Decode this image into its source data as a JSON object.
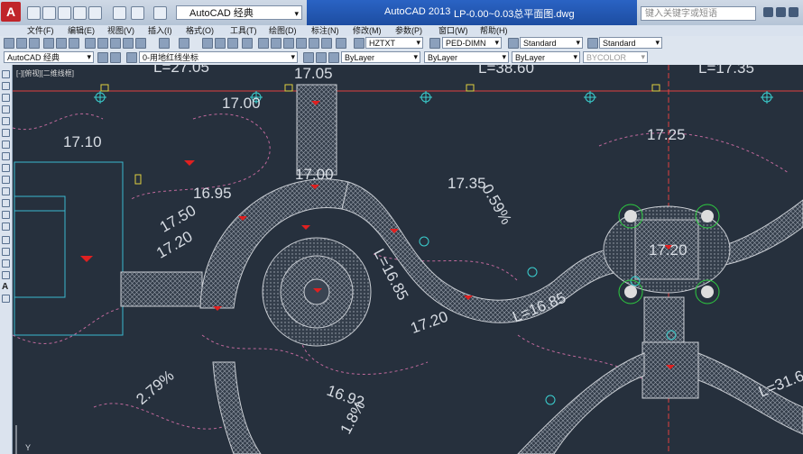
{
  "titlebar": {
    "workspace": "AutoCAD 经典",
    "app_version": "AutoCAD 2013",
    "document": "LP-0.00~0.03总平面图.dwg",
    "search_placeholder": "键入关键字或短语"
  },
  "menu": {
    "items": [
      "文件(F)",
      "编辑(E)",
      "视图(V)",
      "插入(I)",
      "格式(O)",
      "工具(T)",
      "绘图(D)",
      "标注(N)",
      "修改(M)",
      "参数(P)",
      "窗口(W)",
      "帮助(H)"
    ]
  },
  "styles_toolbar": {
    "text_style": "HZTXT",
    "dim_style": "PED-DIMN",
    "table_style": "Standard",
    "multileader_style": "Standard"
  },
  "layers_toolbar": {
    "workspace": "AutoCAD 经典",
    "current_layer": "0-用地红线坐标",
    "color": "ByLayer",
    "linetype": "ByLayer",
    "lineweight": "ByLayer",
    "plot_style": "BYCOLOR"
  },
  "viewport": {
    "label": "[-][俯视][二维线框]"
  },
  "drawing": {
    "labels": {
      "l_top_left": "L=27.05",
      "l_top_mid": "17.05",
      "l_top_right": "L=38.60",
      "l_top_far": "L=17.35",
      "e_17_00_a": "17.00",
      "e_17_10": "17.10",
      "e_17_25": "17.25",
      "e_17_00_b": "17.00",
      "e_16_95": "16.95",
      "e_17_35": "17.35",
      "slope_059": "0.59%",
      "e_17_50": "17.50",
      "e_17_20_a": "17.20",
      "l_16_85_a": "L=16.85",
      "l_16_85_b": "L=16.85",
      "e_17_20_b": "17.20",
      "e_17_20_c": "17.20",
      "slope_279": "2.79%",
      "e_16_92": "16.92",
      "slope_1_8": "1.8%",
      "l_31_6": "L=31.6",
      "axis_y": "Y"
    },
    "colors": {
      "background": "#26303d",
      "contour": "#c0699c",
      "paving": "#8c94a0",
      "marker": "#e02020",
      "tree": "#3bd0d0",
      "text": "#d8dde4",
      "redline": "#e04040"
    }
  }
}
